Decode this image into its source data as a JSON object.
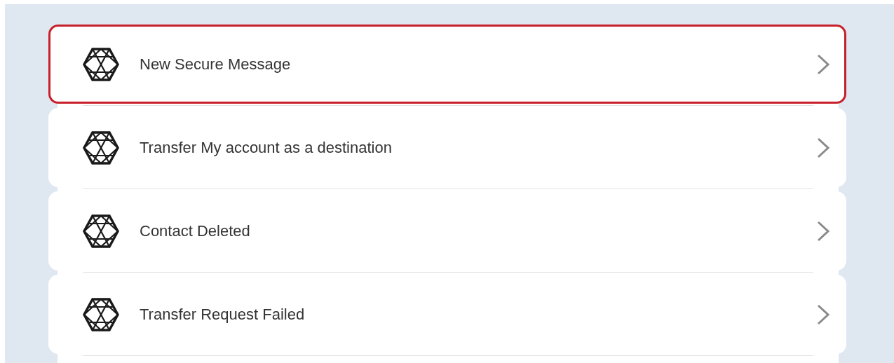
{
  "items": [
    {
      "label": "New Secure Message",
      "selected": true
    },
    {
      "label": "Transfer My account as a destination",
      "selected": false
    },
    {
      "label": "Contact Deleted",
      "selected": false
    },
    {
      "label": "Transfer Request Failed",
      "selected": false
    }
  ]
}
